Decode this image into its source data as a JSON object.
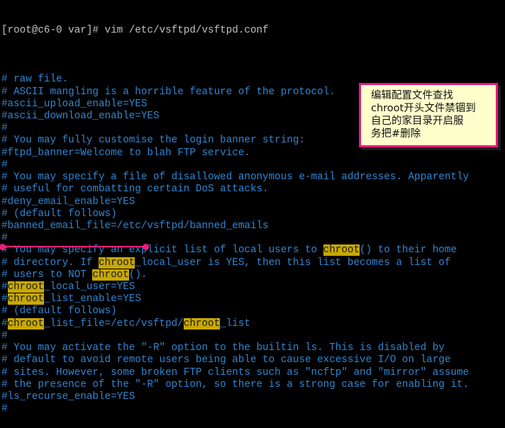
{
  "terminal": {
    "prompt": "[root@c6-0 var]# vim /etc/vsftpd/vsftpd.conf",
    "highlight_term": "chroot",
    "lines": [
      "",
      "# raw file.",
      "# ASCII mangling is a horrible feature of the protocol.",
      "#ascii_upload_enable=YES",
      "#ascii_download_enable=YES",
      "#",
      "# You may fully customise the login banner string:",
      "#ftpd_banner=Welcome to blah FTP service.",
      "#",
      "# You may specify a file of disallowed anonymous e-mail addresses. Apparently",
      "# useful for combatting certain DoS attacks.",
      "#deny_email_enable=YES",
      "# (default follows)",
      "#banned_email_file=/etc/vsftpd/banned_emails",
      "#",
      "# You may specify an explicit list of local users to chroot() to their home",
      "# directory. If chroot_local_user is YES, then this list becomes a list of",
      "# users to NOT chroot().",
      "#chroot_local_user=YES",
      "#chroot_list_enable=YES",
      "# (default follows)",
      "#chroot_list_file=/etc/vsftpd/chroot_list",
      "#",
      "# You may activate the \"-R\" option to the builtin ls. This is disabled by",
      "# default to avoid remote users being able to cause excessive I/O on large",
      "# sites. However, some broken FTP clients such as \"ncftp\" and \"mirror\" assume",
      "# the presence of the \"-R\" option, so there is a strong case for enabling it.",
      "#ls_recurse_enable=YES",
      "#"
    ]
  },
  "annotation": {
    "lines": [
      "编辑配置文件查找",
      "chroot开头文件禁锢到",
      "自己的家目录开启服",
      "务把#删除"
    ],
    "border_color": "#e6197a",
    "fill_color": "#ffffcc"
  },
  "colors": {
    "comment": "#2f86d2",
    "highlight": "#c8a800",
    "marker": "#ee1c7a"
  }
}
